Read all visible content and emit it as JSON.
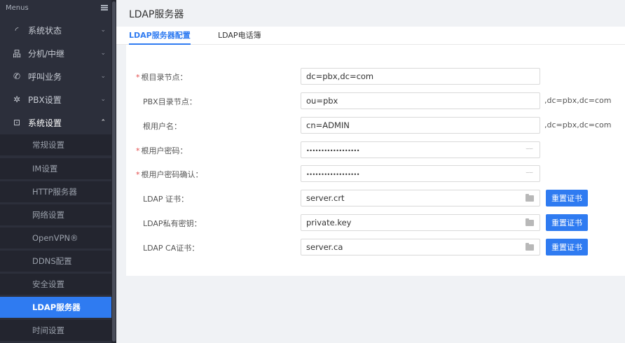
{
  "sidebar": {
    "header": "Menus",
    "items": [
      {
        "label": "系统状态",
        "icon": "gauge-icon"
      },
      {
        "label": "分机/中继",
        "icon": "sitemap-icon"
      },
      {
        "label": "呼叫业务",
        "icon": "phone-icon"
      },
      {
        "label": "PBX设置",
        "icon": "gear-icon"
      },
      {
        "label": "系统设置",
        "icon": "system-settings-icon"
      }
    ],
    "subitems": [
      {
        "label": "常规设置"
      },
      {
        "label": "IM设置"
      },
      {
        "label": "HTTP服务器"
      },
      {
        "label": "网络设置"
      },
      {
        "label": "OpenVPN®"
      },
      {
        "label": "DDNS配置"
      },
      {
        "label": "安全设置"
      },
      {
        "label": "LDAP服务器"
      },
      {
        "label": "时间设置"
      }
    ]
  },
  "main": {
    "title": "LDAP服务器",
    "tabs": [
      {
        "label": "LDAP服务器配置"
      },
      {
        "label": "LDAP电话簿"
      }
    ],
    "form": {
      "rows": [
        {
          "label": "根目录节点：",
          "required": "*",
          "value": "dc=pbx,dc=com"
        },
        {
          "label": "PBX目录节点：",
          "value": "ou=pbx",
          "suffix": ",dc=pbx,dc=com"
        },
        {
          "label": "根用户名：",
          "value": "cn=ADMIN",
          "suffix": ",dc=pbx,dc=com"
        },
        {
          "label": "根用户密码：",
          "required": "*",
          "value": "••••••••••••••••••"
        },
        {
          "label": "根用户密码确认：",
          "required": "*",
          "value": "••••••••••••••••••"
        },
        {
          "label": "LDAP 证书：",
          "value": "server.crt",
          "button": "重置证书"
        },
        {
          "label": "LDAP私有密钥：",
          "value": "private.key",
          "button": "重置证书"
        },
        {
          "label": "LDAP CA证书：",
          "value": "server.ca",
          "button": "重置证书"
        }
      ]
    }
  },
  "colors": {
    "accent": "#2f7bf1",
    "sidebar_bg": "#2c2f3b",
    "required": "#e34d4d"
  }
}
